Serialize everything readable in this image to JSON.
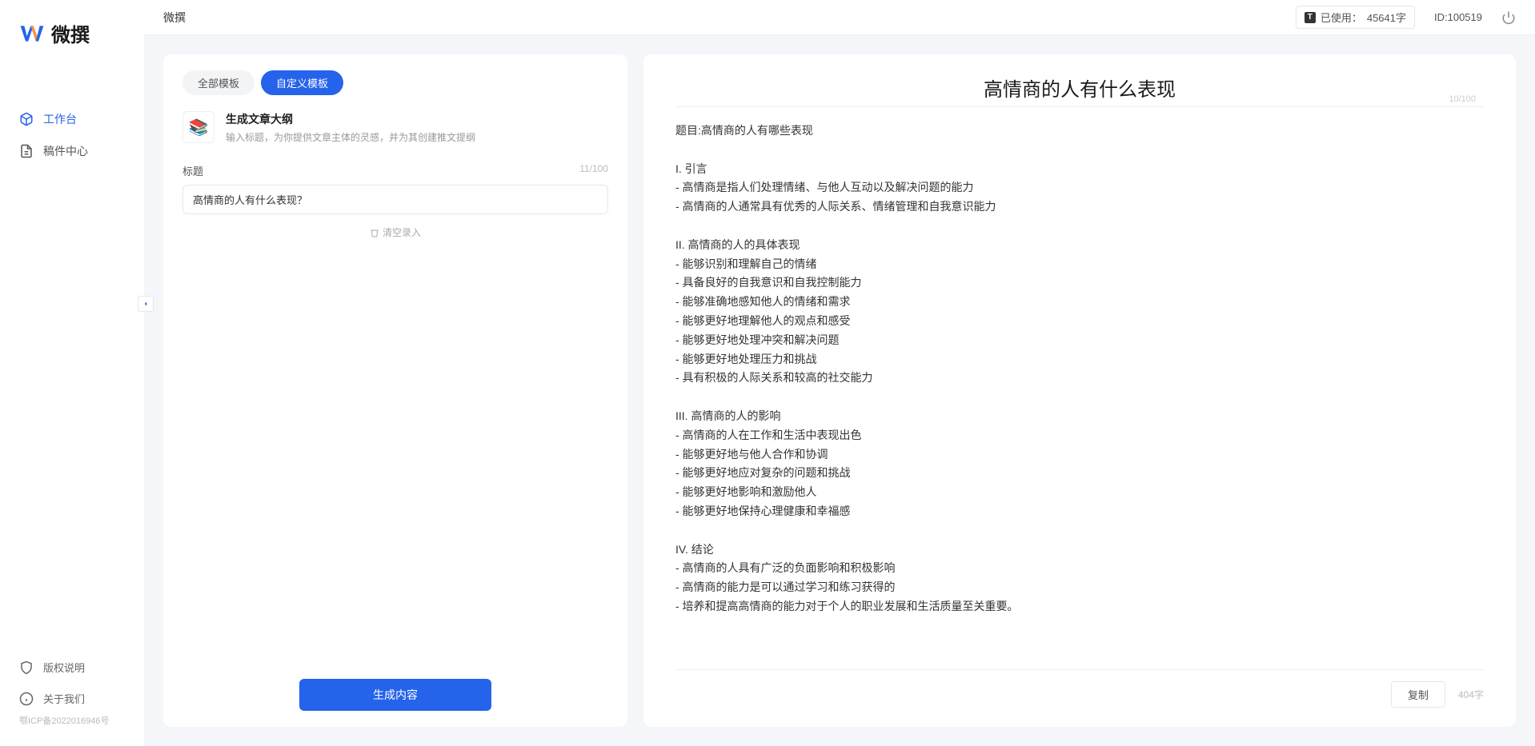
{
  "app": {
    "name": "微撰",
    "logo_text": "微撰"
  },
  "sidebar": {
    "nav": [
      {
        "label": "工作台",
        "active": true
      },
      {
        "label": "稿件中心",
        "active": false
      }
    ],
    "bottom": [
      {
        "label": "版权说明"
      },
      {
        "label": "关于我们"
      }
    ],
    "icp": "鄂ICP备2022016946号"
  },
  "topbar": {
    "title": "微撰",
    "usage_label": "已使用：",
    "usage_value": "45641字",
    "id_label": "ID:100519"
  },
  "editor": {
    "tabs": [
      {
        "label": "全部模板",
        "active": false
      },
      {
        "label": "自定义模板",
        "active": true
      }
    ],
    "template": {
      "name": "生成文章大纲",
      "desc": "输入标题，为你提供文章主体的灵感，并为其创建推文提纲"
    },
    "field": {
      "label": "标题",
      "counter": "11/100",
      "value": "高情商的人有什么表现？"
    },
    "clear": "清空录入",
    "generate": "生成内容"
  },
  "output": {
    "title": "高情商的人有什么表现",
    "counter": "10/100",
    "body": "题目:高情商的人有哪些表现\n\nI. 引言\n- 高情商是指人们处理情绪、与他人互动以及解决问题的能力\n- 高情商的人通常具有优秀的人际关系、情绪管理和自我意识能力\n\nII. 高情商的人的具体表现\n- 能够识别和理解自己的情绪\n- 具备良好的自我意识和自我控制能力\n- 能够准确地感知他人的情绪和需求\n- 能够更好地理解他人的观点和感受\n- 能够更好地处理冲突和解决问题\n- 能够更好地处理压力和挑战\n- 具有积极的人际关系和较高的社交能力\n\nIII. 高情商的人的影响\n- 高情商的人在工作和生活中表现出色\n- 能够更好地与他人合作和协调\n- 能够更好地应对复杂的问题和挑战\n- 能够更好地影响和激励他人\n- 能够更好地保持心理健康和幸福感\n\nIV. 结论\n- 高情商的人具有广泛的负面影响和积极影响\n- 高情商的能力是可以通过学习和练习获得的\n- 培养和提高高情商的能力对于个人的职业发展和生活质量至关重要。",
    "copy": "复制",
    "word_count": "404字"
  }
}
